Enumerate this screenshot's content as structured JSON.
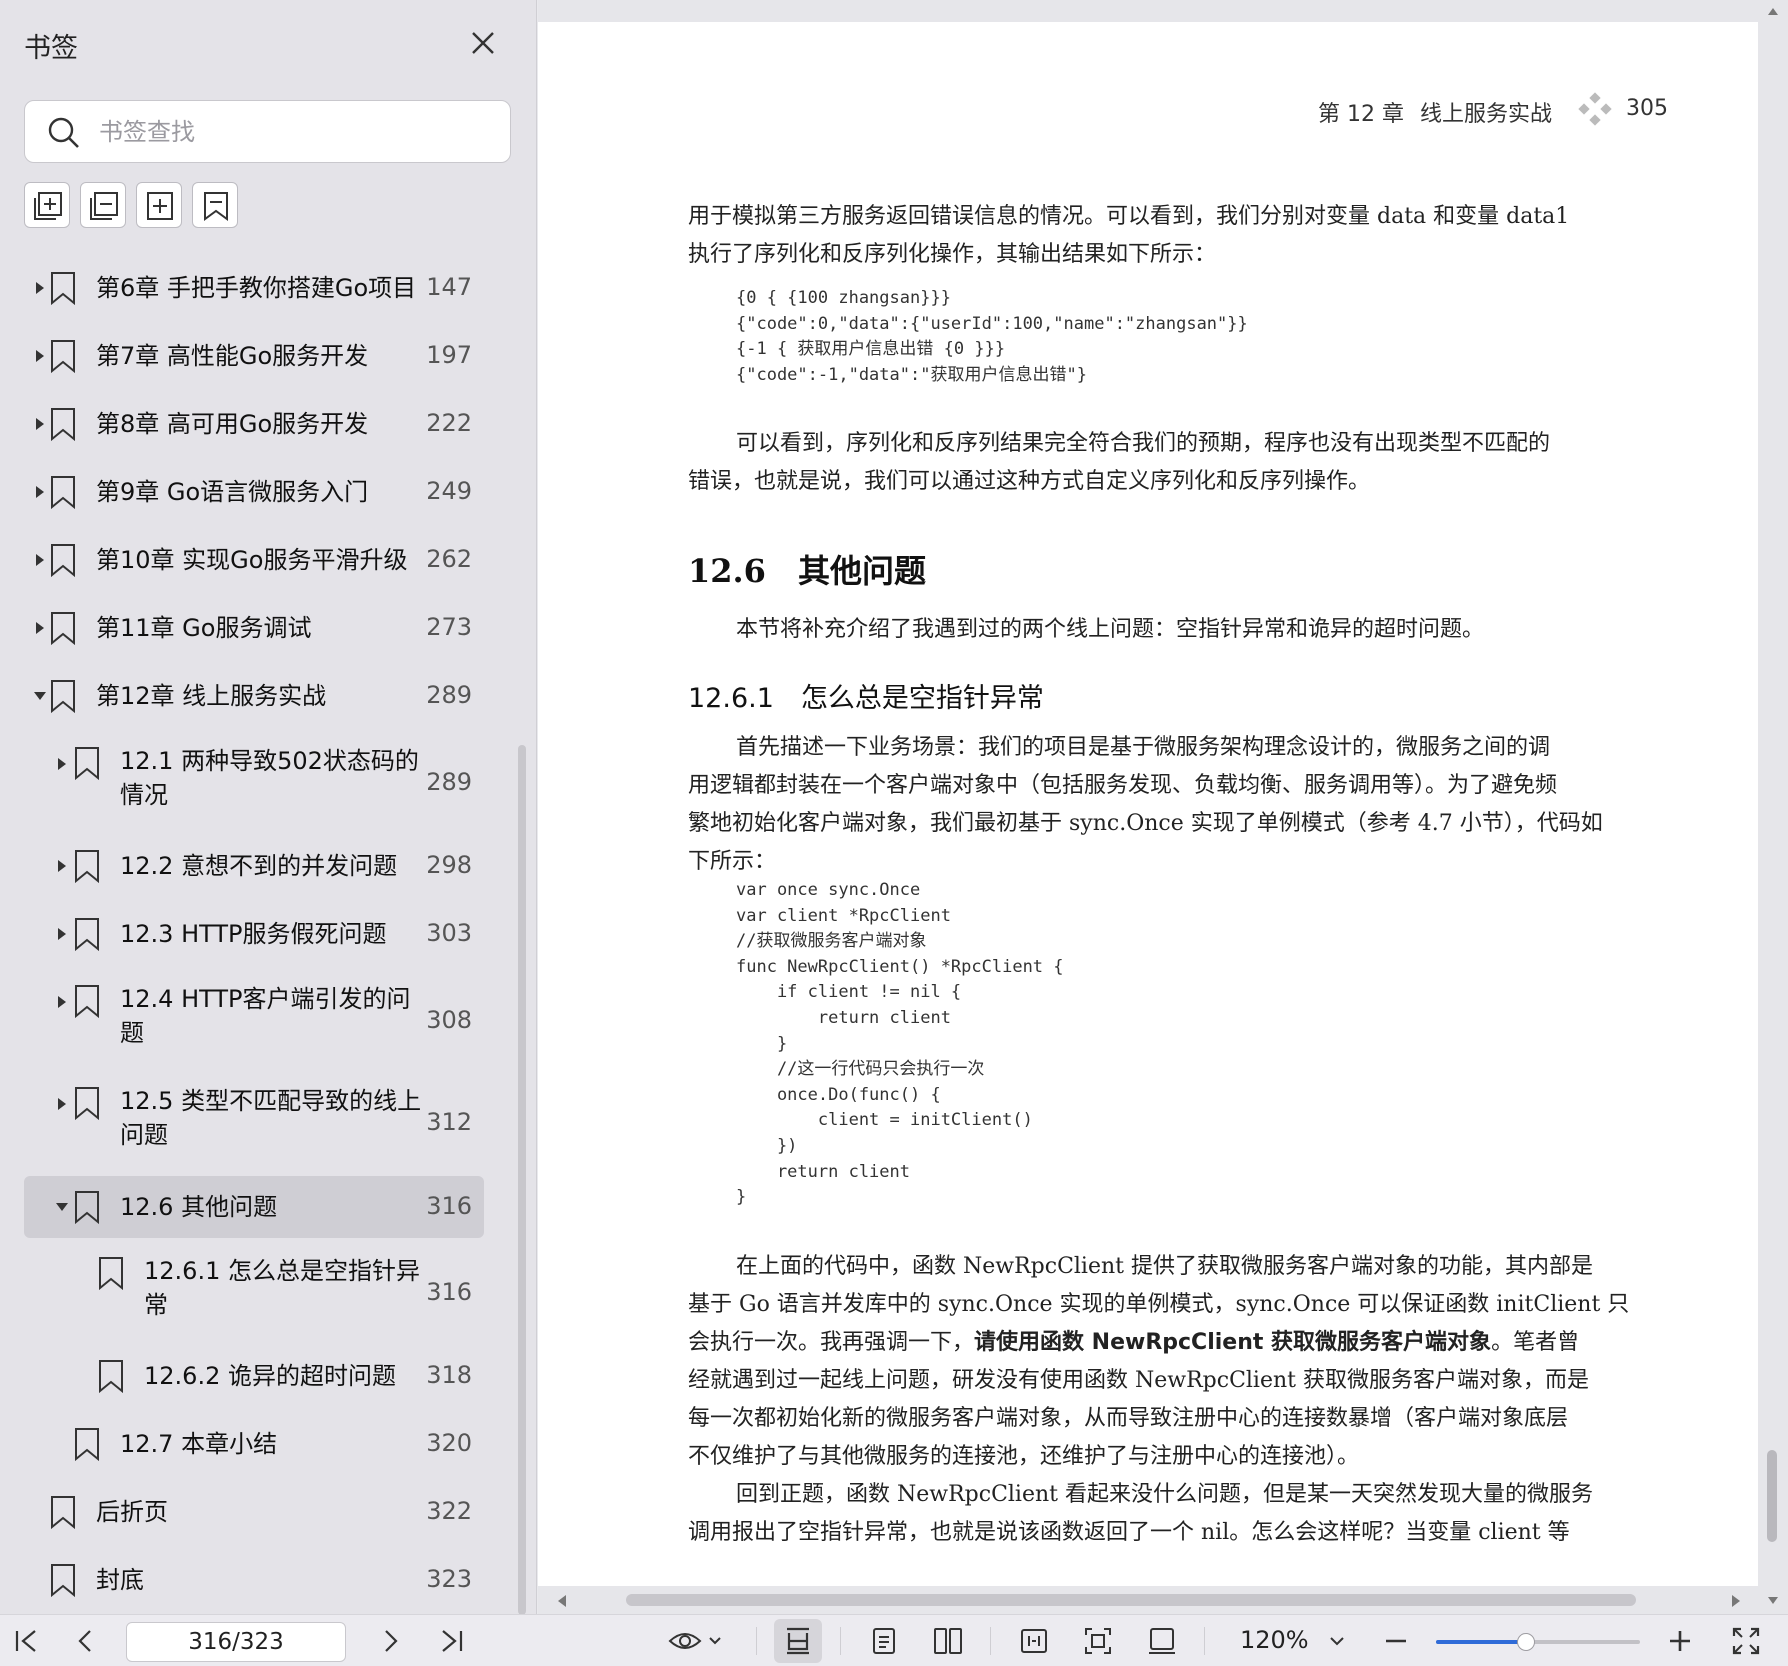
{
  "sidebar": {
    "title": "书签",
    "search_placeholder": "书签查找",
    "bookmarks": [
      {
        "label": "第6章 手把手教你搭建Go项目",
        "page": "147",
        "expanded": false
      },
      {
        "label": "第7章 高性能Go服务开发",
        "page": "197",
        "expanded": false
      },
      {
        "label": "第8章 高可用Go服务开发",
        "page": "222",
        "expanded": false
      },
      {
        "label": "第9章 Go语言微服务入门",
        "page": "249",
        "expanded": false
      },
      {
        "label": "第10章 实现Go服务平滑升级",
        "page": "262",
        "expanded": false
      },
      {
        "label": "第11章 Go服务调试",
        "page": "273",
        "expanded": false
      },
      {
        "label": "第12章 线上服务实战",
        "page": "289",
        "expanded": true
      },
      {
        "label": "12.1 两种导致502状态码的",
        "label2": "情况",
        "page": "289",
        "expanded": false
      },
      {
        "label": "12.2 意想不到的并发问题",
        "page": "298",
        "expanded": false
      },
      {
        "label": "12.3 HTTP服务假死问题",
        "page": "303",
        "expanded": false
      },
      {
        "label": "12.4 HTTP客户端引发的问",
        "label2": "题",
        "page": "308",
        "expanded": false
      },
      {
        "label": "12.5 类型不匹配导致的线上",
        "label2": "问题",
        "page": "312",
        "expanded": false
      },
      {
        "label": "12.6 其他问题",
        "page": "316",
        "expanded": true,
        "selected": true
      },
      {
        "label": "12.6.1 怎么总是空指针异",
        "label2": "常",
        "page": "316"
      },
      {
        "label": "12.6.2 诡异的超时问题",
        "page": "318"
      },
      {
        "label": "12.7 本章小结",
        "page": "320"
      },
      {
        "label": "后折页",
        "page": "322"
      },
      {
        "label": "封底",
        "page": "323"
      }
    ]
  },
  "page": {
    "running_head_chapter": "第 12 章",
    "running_head_title": "线上服务实战",
    "page_number": "305",
    "para1_l1": "用于模拟第三方服务返回错误信息的情况。可以看到，我们分别对变量 data 和变量 data1",
    "para1_l2": "执行了序列化和反序列化操作，其输出结果如下所示：",
    "code1": "{0 { {100 zhangsan}}}\n{\"code\":0,\"data\":{\"userId\":100,\"name\":\"zhangsan\"}}\n{-1 { 获取用户信息出错 {0 }}}\n{\"code\":-1,\"data\":\"获取用户信息出错\"}",
    "para2_l1": "可以看到，序列化和反序列结果完全符合我们的预期，程序也没有出现类型不匹配的",
    "para2_l2": "错误，也就是说，我们可以通过这种方式自定义序列化和反序列操作。",
    "section_heading": "12.6　其他问题",
    "para3": "本节将补充介绍了我遇到过的两个线上问题：空指针异常和诡异的超时问题。",
    "subsection_heading": "12.6.1　怎么总是空指针异常",
    "para4_l1": "首先描述一下业务场景：我们的项目是基于微服务架构理念设计的，微服务之间的调",
    "para4_l2": "用逻辑都封装在一个客户端对象中（包括服务发现、负载均衡、服务调用等）。为了避免频",
    "para4_l3": "繁地初始化客户端对象，我们最初基于 sync.Once 实现了单例模式（参考 4.7 小节），代码如",
    "para4_l4": "下所示：",
    "code2": "var once sync.Once\nvar client *RpcClient\n//获取微服务客户端对象\nfunc NewRpcClient() *RpcClient {\n    if client != nil {\n        return client\n    }\n    //这一行代码只会执行一次\n    once.Do(func() {\n        client = initClient()\n    })\n    return client\n}",
    "para5_l1": "在上面的代码中，函数 NewRpcClient 提供了获取微服务客户端对象的功能，其内部是",
    "para5_l2": "基于 Go 语言并发库中的 sync.Once 实现的单例模式，sync.Once 可以保证函数 initClient 只",
    "para5_l3a": "会执行一次。我再强调一下，",
    "para5_l3b": "请使用函数 NewRpcClient 获取微服务客户端对象",
    "para5_l3c": "。笔者曾",
    "para5_l4": "经就遇到过一起线上问题，研发没有使用函数 NewRpcClient 获取微服务客户端对象，而是",
    "para5_l5": "每一次都初始化新的微服务客户端对象，从而导致注册中心的连接数暴增（客户端对象底层",
    "para5_l6": "不仅维护了与其他微服务的连接池，还维护了与注册中心的连接池）。",
    "para6_l1": "回到正题，函数 NewRpcClient 看起来没什么问题，但是某一天突然发现大量的微服务",
    "para6_l2": "调用报出了空指针异常，也就是说该函数返回了一个 nil。怎么会这样呢？当变量 client 等"
  },
  "toolbar": {
    "page_indicator": "316/323",
    "zoom": "120%",
    "zoom_fraction": 0.44
  }
}
